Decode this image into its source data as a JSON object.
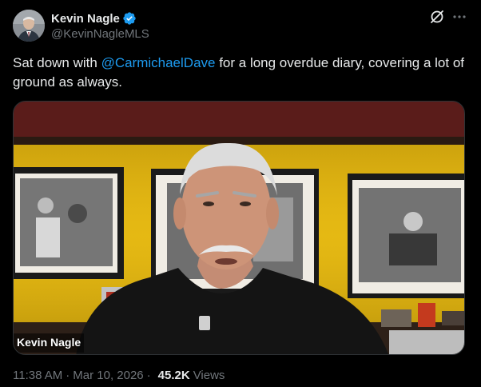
{
  "author": {
    "display_name": "Kevin Nagle",
    "handle": "@KevinNagleMLS",
    "verified": true
  },
  "actions": {
    "grok_icon": "slash-circle-icon",
    "more_icon": "more-icon"
  },
  "tweet": {
    "text_before": "Sat down with ",
    "mention": "@CarmichaelDave",
    "text_after": " for a long overdue diary, covering a lot of ground as always."
  },
  "media": {
    "overlay_name": "Kevin Nagle"
  },
  "meta": {
    "time": "11:38 AM",
    "separator": "·",
    "date": "Mar 10, 2026",
    "views_count": "45.2K",
    "views_label": "Views"
  },
  "colors": {
    "background": "#000000",
    "text": "#e7e9ea",
    "secondary": "#71767b",
    "link": "#1d9bf0",
    "verified": "#1d9bf0"
  }
}
